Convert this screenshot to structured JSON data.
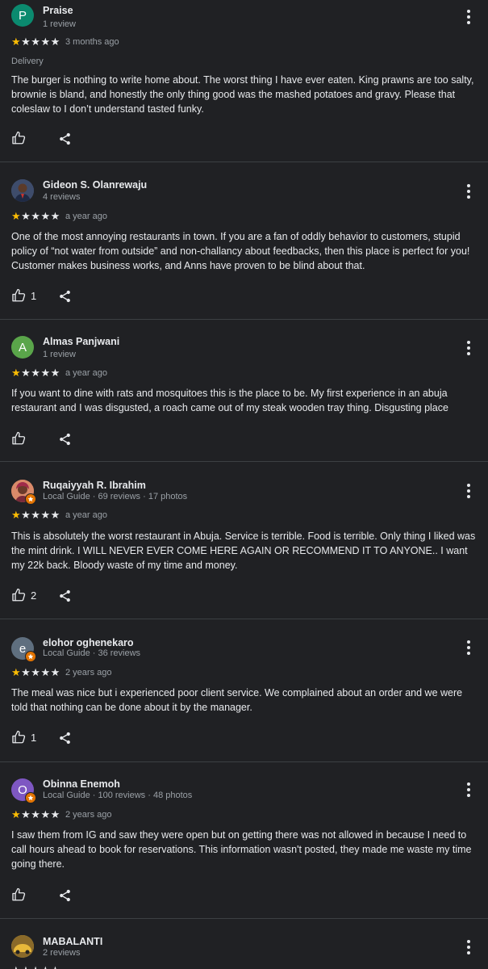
{
  "colors": {
    "background": "#202124",
    "star_filled": "#fbbc04",
    "local_guide_badge": "#e37400"
  },
  "reviews": [
    {
      "author": "Praise",
      "meta": "1 review",
      "avatar_letter": "P",
      "avatar_color": "#0b8a6f",
      "rating": 1,
      "date": "3 months ago",
      "tag": "Delivery",
      "text": "The burger is nothing to write home about. The worst thing I have ever eaten. King prawns are too salty, brownie is bland, and honestly the only thing good was the mashed potatoes and gravy. Please that coleslaw to I don’t understand tasted funky.",
      "likes": ""
    },
    {
      "author": "Gideon S. Olanrewaju",
      "meta": "4 reviews",
      "avatar_letter": "",
      "avatar_color": "#3a4a66",
      "rating": 1,
      "date": "a year ago",
      "text": "One of the most annoying restaurants in town. If you are a fan of oddly behavior to customers, stupid policy of “not water from outside” and non-challancy about feedbacks, then this place is perfect for you! Customer makes business works, and Anns have proven to be blind about that.",
      "likes": "1"
    },
    {
      "author": "Almas Panjwani",
      "meta": "1 review",
      "avatar_letter": "A",
      "avatar_color": "#5aa54a",
      "rating": 1,
      "date": "a year ago",
      "text": "If you want to dine with rats and mosquitoes this is the place to be. My first experience in an abuja restaurant and I was disgusted, a roach came out of my steak wooden tray thing. Disgusting place",
      "likes": ""
    },
    {
      "author": "Ruqaiyyah R. Ibrahim",
      "meta": "Local Guide · 69 reviews · 17 photos",
      "avatar_letter": "",
      "avatar_color": "#b0654a",
      "rating": 1,
      "date": "a year ago",
      "text": "This is absolutely the worst restaurant in Abuja. Service is terrible. Food is terrible. Only thing I liked was the mint drink. I WILL NEVER EVER COME HERE AGAIN OR RECOMMEND IT TO ANYONE.. I want my 22k back. Bloody waste of my time and money.",
      "likes": "2"
    },
    {
      "author": "elohor oghenekaro",
      "meta": "Local Guide · 36 reviews",
      "avatar_letter": "e",
      "avatar_color": "#5f6f7f",
      "rating": 1,
      "date": "2 years ago",
      "text": "The meal was nice but i experienced poor client service. We complained about an order and we were told that nothing can be done about it by the manager.",
      "likes": "1"
    },
    {
      "author": "Obinna Enemoh",
      "meta": "Local Guide · 100 reviews · 48 photos",
      "avatar_letter": "O",
      "avatar_color": "#7e57c2",
      "rating": 1,
      "date": "2 years ago",
      "text": "I saw them from IG and saw they were open but on getting there was not allowed in because I need to call hours ahead to book for reservations. This information wasn't posted, they made me waste my time going there.",
      "likes": ""
    },
    {
      "author": "MABALANTI",
      "meta": "2 reviews",
      "avatar_letter": "",
      "avatar_color": "#c9a227"
    }
  ]
}
